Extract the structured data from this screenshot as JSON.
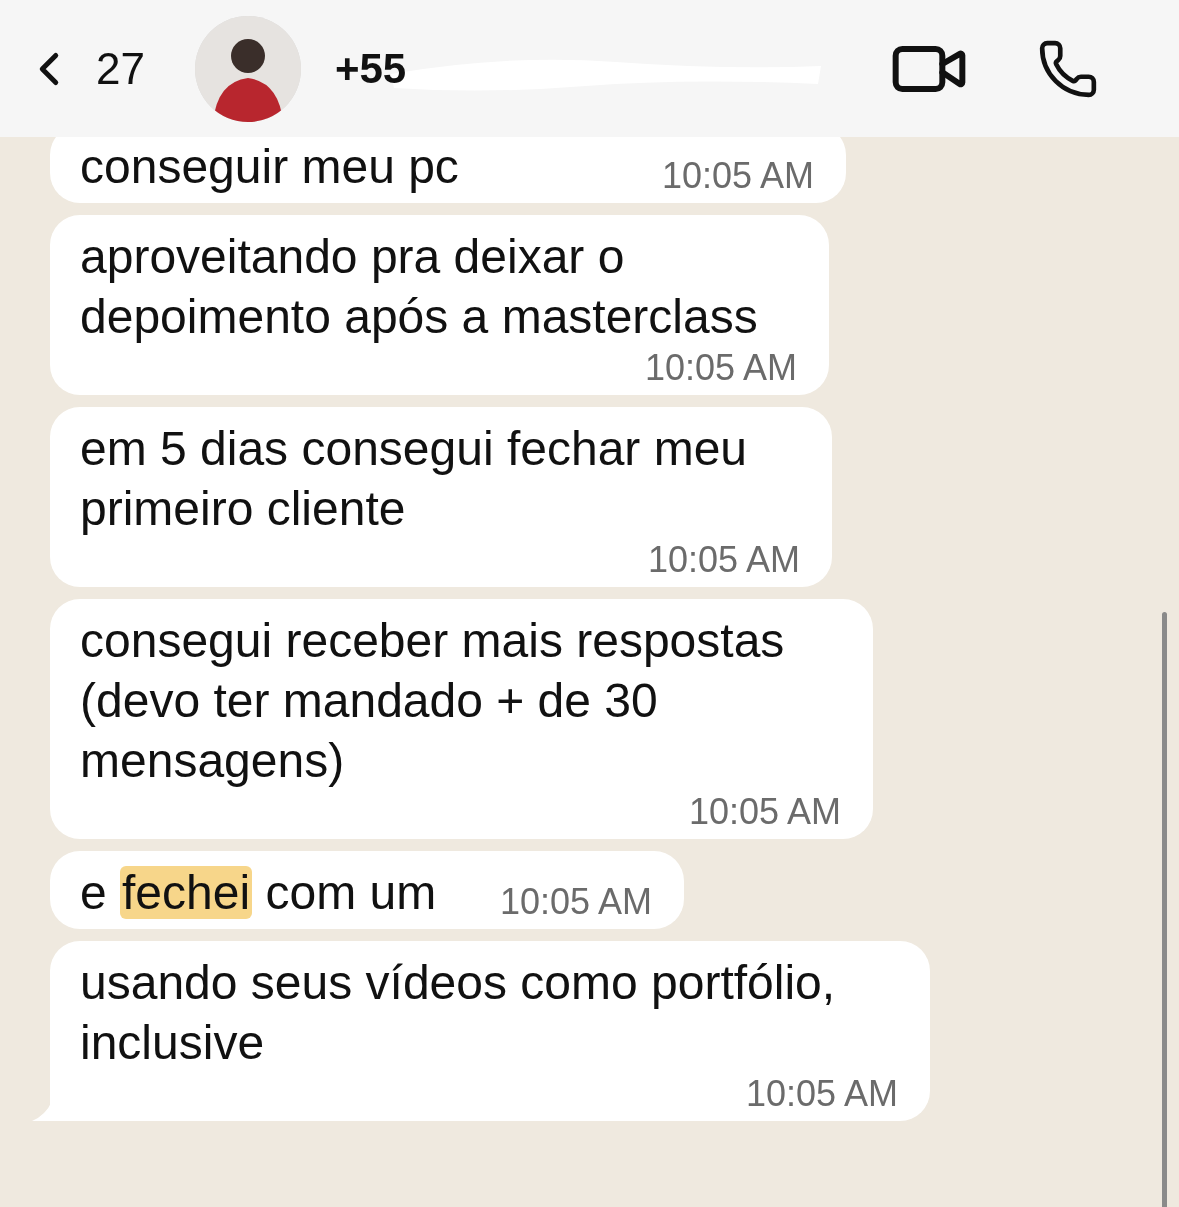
{
  "header": {
    "back_count": "27",
    "contact_name": "+55",
    "name_redacted": true
  },
  "messages": [
    {
      "parts": [
        {
          "text": "conseguir meu pc",
          "highlighted": false
        }
      ],
      "time": "10:05 AM",
      "tail": false
    },
    {
      "parts": [
        {
          "text": "aproveitando pra deixar o depoimento após a masterclass",
          "highlighted": false
        }
      ],
      "time": "10:05 AM",
      "tail": false
    },
    {
      "parts": [
        {
          "text": "em 5 dias consegui fechar meu primeiro cliente",
          "highlighted": false
        }
      ],
      "time": "10:05 AM",
      "tail": false
    },
    {
      "parts": [
        {
          "text": "consegui receber mais respostas (devo ter mandado + de 30 mensagens)",
          "highlighted": false
        }
      ],
      "time": "10:05 AM",
      "tail": false
    },
    {
      "parts": [
        {
          "text": "e ",
          "highlighted": false
        },
        {
          "text": "fechei",
          "highlighted": true
        },
        {
          "text": " com um",
          "highlighted": false
        }
      ],
      "time": "10:05 AM",
      "tail": false
    },
    {
      "parts": [
        {
          "text": "usando seus vídeos como portfólio, inclusive",
          "highlighted": false
        }
      ],
      "time": "10:05 AM",
      "tail": true
    }
  ]
}
